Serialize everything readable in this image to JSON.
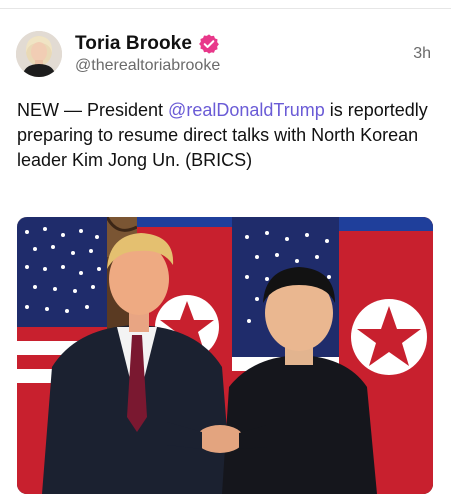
{
  "post": {
    "author": {
      "display_name": "Toria Brooke",
      "handle": "@therealtoriabrooke",
      "verified": true,
      "verified_color": "#e8388a"
    },
    "timestamp": "3h",
    "text": {
      "prefix": "NEW — President ",
      "mention": "@realDonaldTrump",
      "suffix": " is reportedly preparing to resume direct talks with North Korean leader Kim Jong Un. (BRICS)"
    },
    "media": {
      "type": "photo"
    }
  },
  "colors": {
    "mention": "#6a5bd6",
    "secondary_text": "#6b6b6b",
    "verified_badge": "#e8388a"
  },
  "icons": {
    "verified": "verified-badge-icon"
  }
}
